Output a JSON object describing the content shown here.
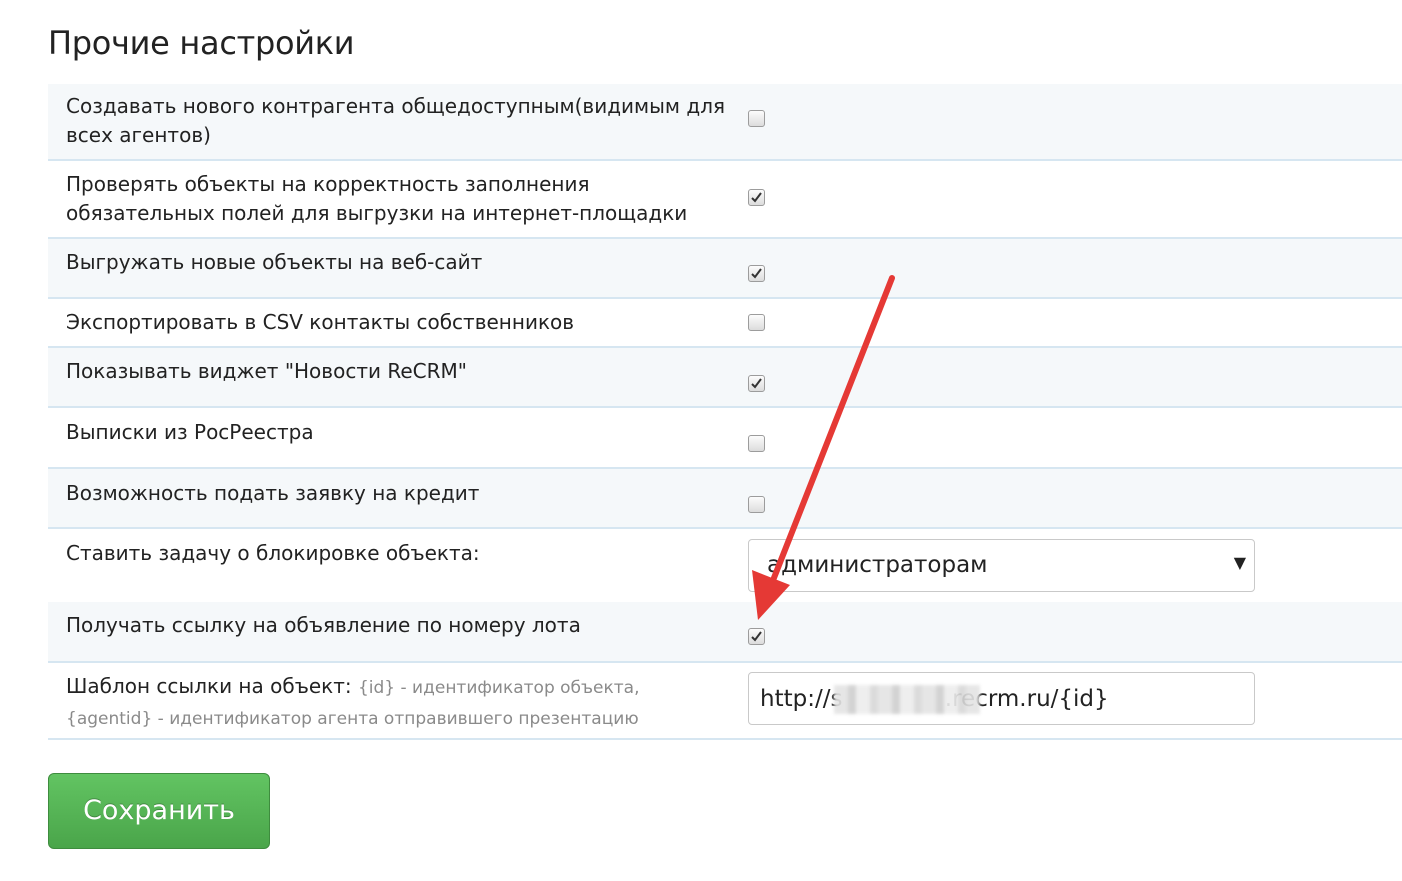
{
  "page_title": "Прочие настройки",
  "settings": {
    "row1_label": "Создавать нового контрагента общедоступным(видимым для всех агентов)",
    "row2_label": "Проверять объекты на корректность заполнения обязательных полей для выгрузки на интернет-площадки",
    "row3_label": "Выгружать новые объекты на веб-сайт",
    "row4_label": "Экспортировать в CSV контакты собственников",
    "row5_label": "Показывать виджет \"Новости ReCRM\"",
    "row6_label": "Выписки из РосРеестра",
    "row7_label": "Возможность подать заявку на кредит",
    "row8_label": "Ставить задачу о блокировке объекта:",
    "row8_select_value": "администраторам",
    "row9_label": "Получать ссылку на объявление по номеру лота",
    "row10_label": "Шаблон ссылки на объект:",
    "row10_hint": "{id} - идентификатор объекта, {agentid} - идентификатор агента отправившего презентацию",
    "row10_input_value": "http://s              .recrm.ru/{id}"
  },
  "checkbox_states": {
    "row1": false,
    "row2": true,
    "row3": true,
    "row4": false,
    "row5": true,
    "row6": false,
    "row7": false,
    "row9": true
  },
  "icons": {
    "select_caret": "▼",
    "annotation": "red-arrow-icon"
  },
  "save_button_label": "Сохранить",
  "colors": {
    "save_button": "#5cb85c",
    "row_separator": "#d6e6f1",
    "stripe": "#f5f8fa",
    "annotation_arrow": "#e53935"
  }
}
